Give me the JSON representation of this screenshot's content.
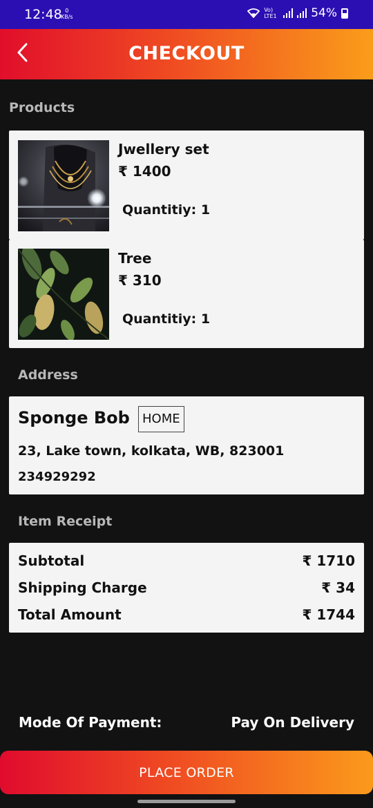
{
  "status_bar": {
    "time": "12:48",
    "speed_value": "0",
    "speed_unit": "KB/s",
    "network_label": "Vo) LTE1",
    "battery": "54%"
  },
  "app_bar": {
    "title": "CHECKOUT",
    "back_icon": "chevron-left-icon",
    "gradient": [
      "#e10e2b",
      "#fa9d1a"
    ]
  },
  "products_section": {
    "label": "Products",
    "items": [
      {
        "name": "Jwellery set",
        "price": "₹ 1400",
        "quantity": "Quantitiy: 1",
        "thumbnail": "jewellery-photo"
      },
      {
        "name": "Tree",
        "price": "₹ 310",
        "quantity": "Quantitiy: 1",
        "thumbnail": "leaves-photo"
      }
    ]
  },
  "address_section": {
    "label": "Address",
    "name": "Sponge Bob",
    "tag": "HOME",
    "line": "23, Lake town, kolkata, WB, 823001",
    "phone": "234929292"
  },
  "receipt_section": {
    "label": "Item Receipt",
    "rows": [
      {
        "label": "Subtotal",
        "value": "₹ 1710"
      },
      {
        "label": "Shipping Charge",
        "value": "₹ 34"
      },
      {
        "label": "Total Amount",
        "value": "₹ 1744"
      }
    ]
  },
  "payment": {
    "label": "Mode Of Payment:",
    "value": "Pay On Delivery"
  },
  "place_order": {
    "label": "PLACE ORDER"
  },
  "colors": {
    "background": "#121212",
    "card": "#f4f4f4",
    "section_label": "#b8b8b8"
  }
}
